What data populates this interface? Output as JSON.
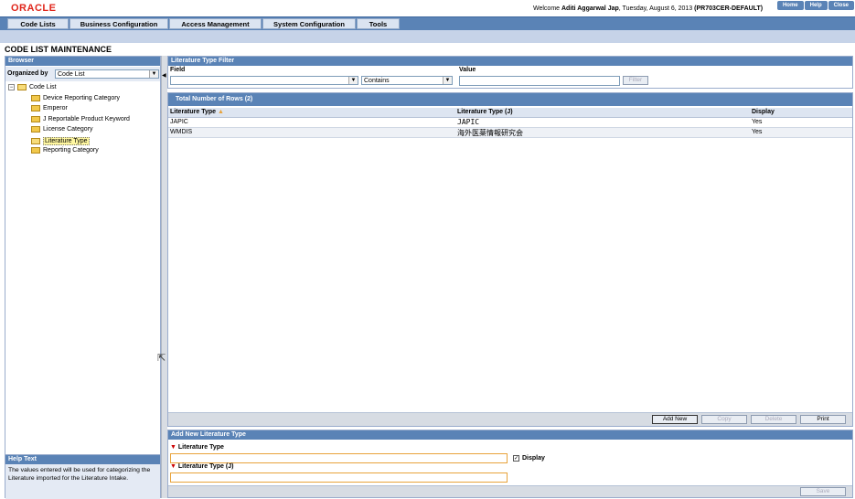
{
  "header": {
    "logo": "ORACLE",
    "welcome_prefix": "Welcome ",
    "user": "Aditi Aggarwal Jap",
    "date": ", Tuesday, August 6, 2013 ",
    "site": "(PR703CER-DEFAULT)",
    "buttons": [
      "Home",
      "Help",
      "Close"
    ]
  },
  "menu": [
    "Code Lists",
    "Business Configuration",
    "Access Management",
    "System Configuration",
    "Tools"
  ],
  "page_title": "CODE LIST MAINTENANCE",
  "browser": {
    "title": "Browser",
    "organized_by_label": "Organized by",
    "organized_by_value": "Code List",
    "root": "Code List",
    "items": [
      "Device Reporting Category",
      "Emperor",
      "J Reportable Product Keyword",
      "License Category",
      "Literature Type",
      "Reporting Category"
    ]
  },
  "help": {
    "title": "Help Text",
    "text": "The values entered will be used for categorizing the Literature imported for the Literature Intake."
  },
  "filter": {
    "title": "Literature Type Filter",
    "field_label": "Field",
    "field_value": "",
    "operator": "Contains",
    "value_label": "Value",
    "value": "",
    "filter_button": "Filter"
  },
  "grid": {
    "title": "Total Number of Rows (2)",
    "columns": [
      "Literature Type",
      "Literature Type (J)",
      "Display"
    ],
    "rows": [
      [
        "JAPIC",
        "JAPIC",
        "Yes"
      ],
      [
        "WMDIS",
        "海外医薬情報研究会",
        "Yes"
      ]
    ],
    "buttons": [
      "Add New",
      "Copy",
      "Delete",
      "Print"
    ]
  },
  "add": {
    "title": "Add New Literature Type",
    "field1_label": "Literature Type",
    "field2_label": "Literature Type (J)",
    "display_label": "Display",
    "save_button": "Save"
  },
  "colors": {
    "accent": "#5a83b6",
    "logo": "#e0261b"
  }
}
